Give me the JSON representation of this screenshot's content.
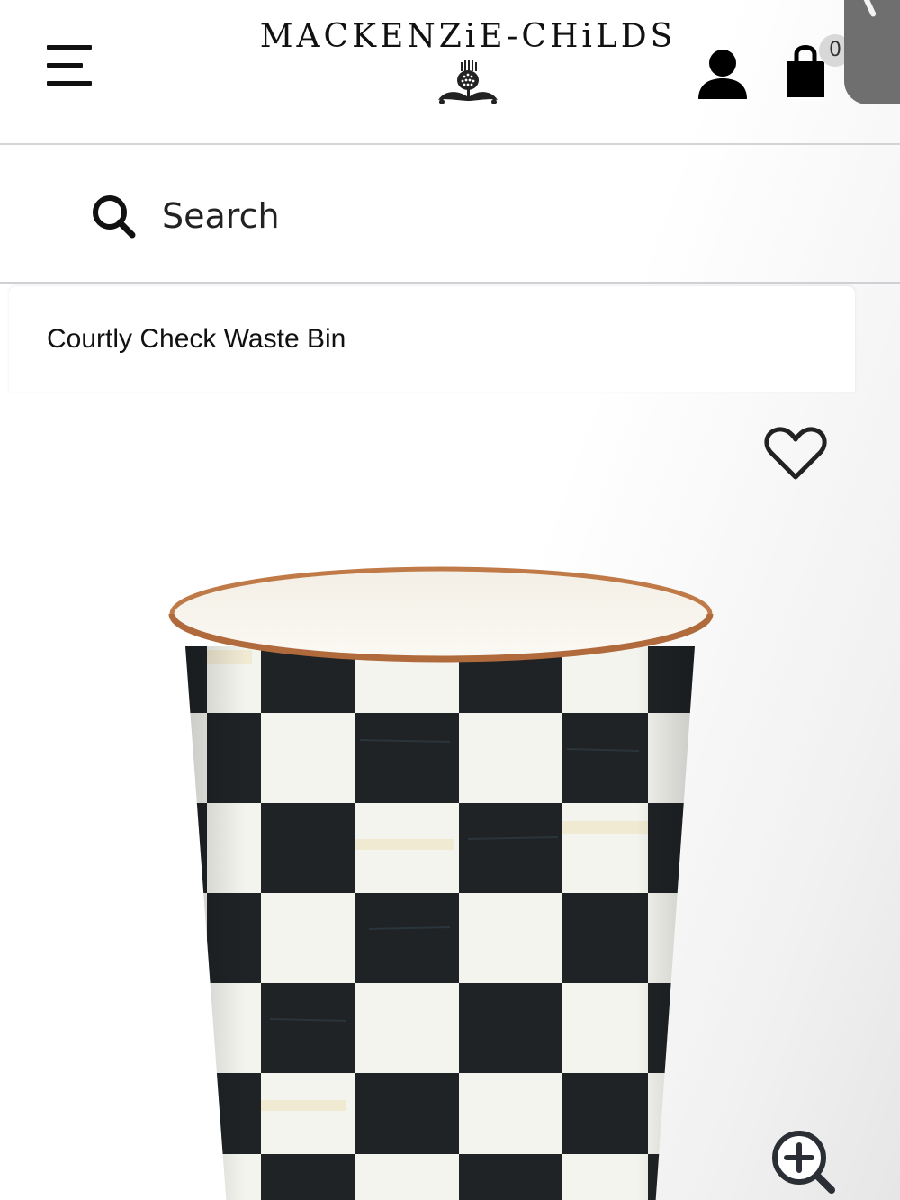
{
  "header": {
    "brand_name": "MACKENZiE-CHiLDS",
    "cart_count": "0"
  },
  "search": {
    "label": "Search"
  },
  "product": {
    "title": "Courtly Check Waste Bin"
  },
  "icons": {
    "menu": "hamburger-menu-icon",
    "account": "person-icon",
    "cart": "shopping-bag-icon",
    "search": "magnifier-icon",
    "wishlist": "heart-outline-icon",
    "zoom": "zoom-in-icon"
  },
  "colors": {
    "text": "#111111",
    "divider": "#d4d4d8",
    "copper_rim": "#b06a3b",
    "check_dark": "#1f2326",
    "check_light": "#f4f4ef"
  }
}
